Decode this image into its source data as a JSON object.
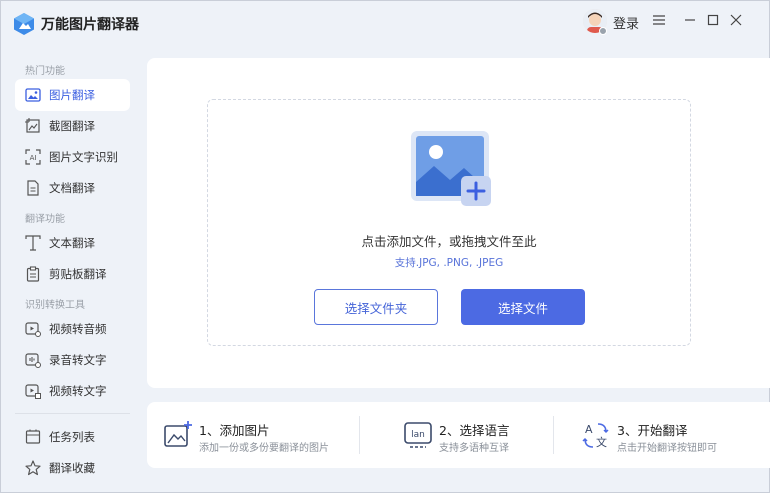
{
  "app": {
    "title": "万能图片翻译器"
  },
  "header": {
    "login_label": "登录"
  },
  "sidebar": {
    "sections": [
      {
        "title": "热门功能",
        "items": [
          {
            "label": "图片翻译",
            "icon": "image-icon",
            "active": true
          },
          {
            "label": "截图翻译",
            "icon": "screenshot-icon"
          },
          {
            "label": "图片文字识别",
            "icon": "ocr-icon"
          },
          {
            "label": "文档翻译",
            "icon": "document-icon"
          }
        ]
      },
      {
        "title": "翻译功能",
        "items": [
          {
            "label": "文本翻译",
            "icon": "text-icon"
          },
          {
            "label": "剪贴板翻译",
            "icon": "clipboard-icon"
          }
        ]
      },
      {
        "title": "识别转换工具",
        "items": [
          {
            "label": "视频转音频",
            "icon": "video-audio-icon"
          },
          {
            "label": "录音转文字",
            "icon": "recording-icon"
          },
          {
            "label": "视频转文字",
            "icon": "video-text-icon"
          }
        ]
      }
    ],
    "bottom_items": [
      {
        "label": "任务列表",
        "icon": "task-list-icon"
      },
      {
        "label": "翻译收藏",
        "icon": "star-icon"
      }
    ]
  },
  "upload": {
    "prompt": "点击添加文件，或拖拽文件至此",
    "formats": "支持.JPG, .PNG, .JPEG",
    "choose_folder_label": "选择文件夹",
    "choose_file_label": "选择文件"
  },
  "steps": [
    {
      "title": "1、添加图片",
      "desc": "添加一份或多份要翻译的图片",
      "icon": "add-image-icon"
    },
    {
      "title": "2、选择语言",
      "desc": "支持多语种互译",
      "icon": "language-icon"
    },
    {
      "title": "3、开始翻译",
      "desc": "点击开始翻译按钮即可",
      "icon": "translate-icon"
    }
  ],
  "colors": {
    "accent": "#4c6ae3",
    "sidebar_bg": "#eef2f8",
    "card_bg": "#ffffff"
  }
}
